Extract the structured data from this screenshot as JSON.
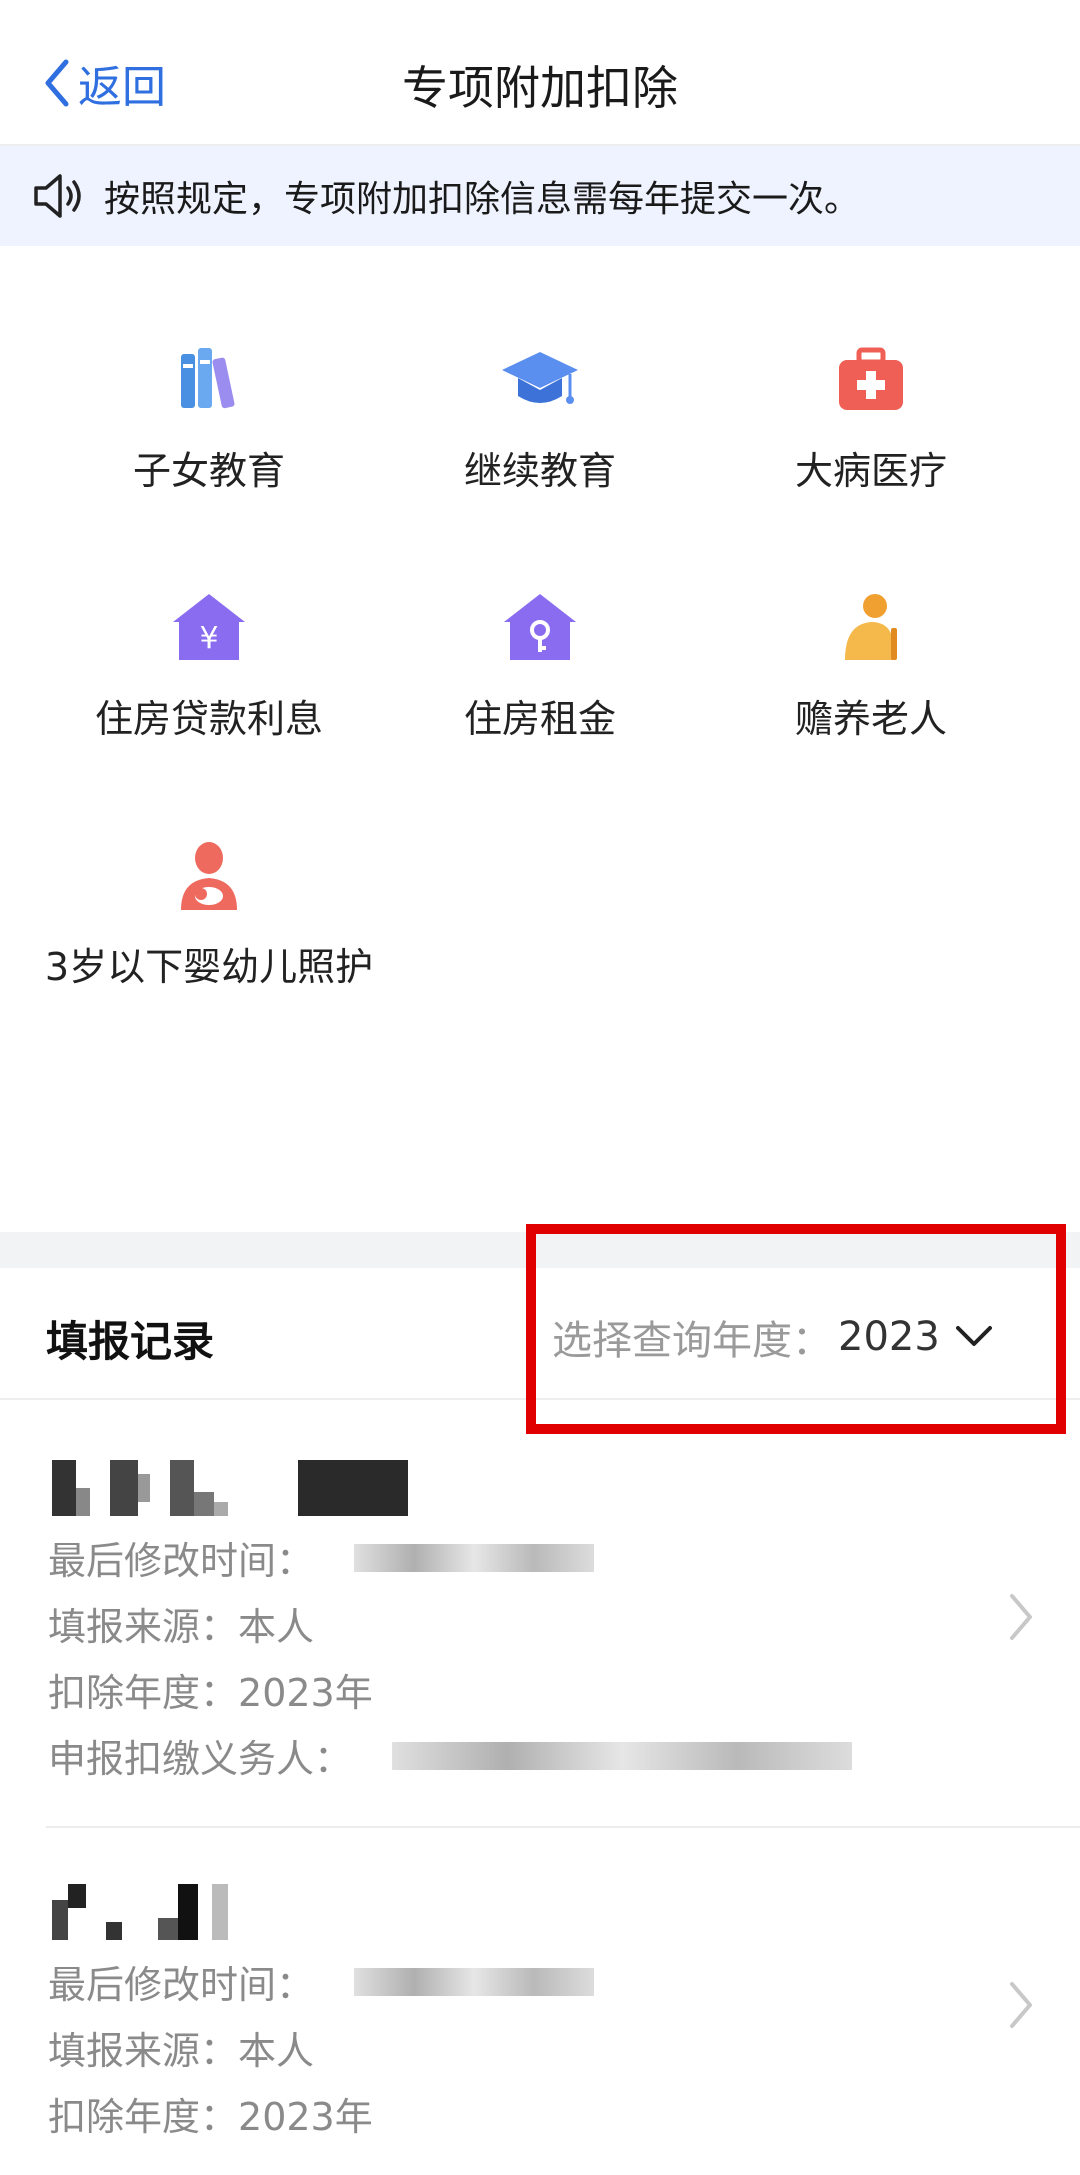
{
  "header": {
    "back_label": "返回",
    "title": "专项附加扣除"
  },
  "notice": {
    "text": "按照规定，专项附加扣除信息需每年提交一次。"
  },
  "categories": [
    {
      "label": "子女教育",
      "icon": "books-icon"
    },
    {
      "label": "继续教育",
      "icon": "graduation-cap-icon"
    },
    {
      "label": "大病医疗",
      "icon": "medical-kit-icon"
    },
    {
      "label": "住房贷款利息",
      "icon": "house-yuan-icon"
    },
    {
      "label": "住房租金",
      "icon": "house-key-icon"
    },
    {
      "label": "赡养老人",
      "icon": "elderly-person-icon"
    },
    {
      "label": "3岁以下婴幼儿照护",
      "icon": "mother-baby-icon"
    }
  ],
  "records_section": {
    "title": "填报记录",
    "year_label": "选择查询年度：",
    "year_value": "2023"
  },
  "records": [
    {
      "modified_label": "最后修改时间：",
      "source_label": "填报来源：",
      "source_value": "本人",
      "year_label": "扣除年度：",
      "year_value": "2023年",
      "withholder_label": "申报扣缴义务人："
    },
    {
      "modified_label": "最后修改时间：",
      "source_label": "填报来源：",
      "source_value": "本人",
      "year_label": "扣除年度：",
      "year_value": "2023年"
    }
  ],
  "colors": {
    "accent": "#2f6fe0",
    "notice_bg": "#eef3ff",
    "highlight": "#e00000",
    "muted_text": "#8a8a8a"
  }
}
